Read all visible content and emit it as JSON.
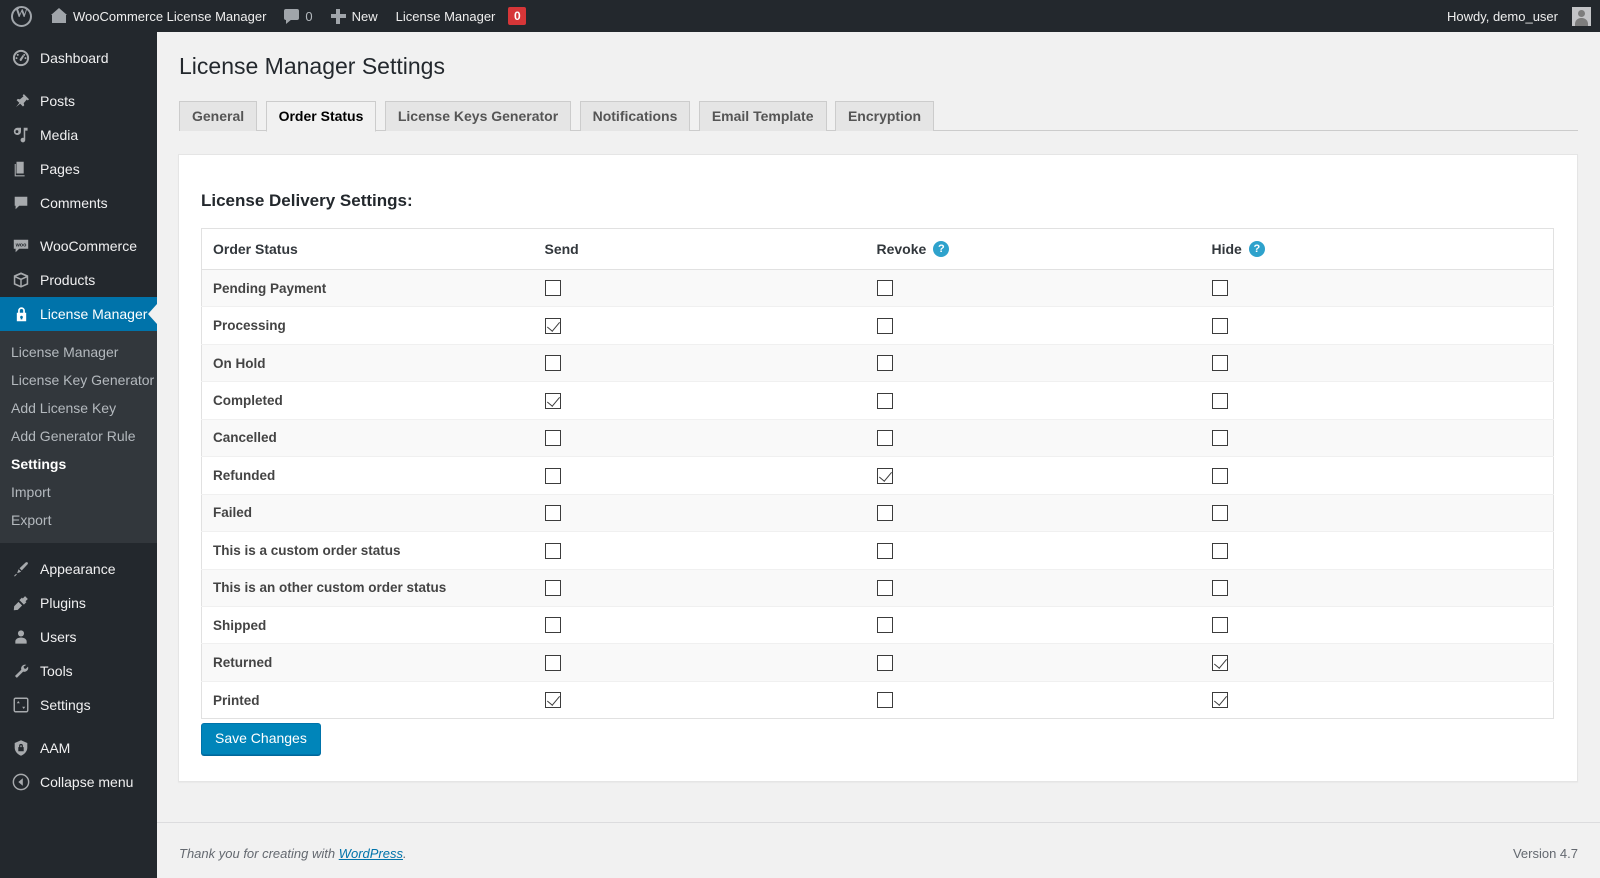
{
  "adminbar": {
    "wp_logo": "wordpress-logo-icon",
    "site_name": "WooCommerce License Manager",
    "comment_count": "0",
    "new_label": "New",
    "plugin_menu": "License Manager",
    "plugin_badge": "0",
    "howdy": "Howdy, demo_user"
  },
  "sidebar": {
    "items": [
      {
        "label": "Dashboard",
        "icon": "dashboard-icon",
        "current": false
      },
      {
        "label": "Posts",
        "icon": "pin-icon",
        "current": false
      },
      {
        "label": "Media",
        "icon": "media-icon",
        "current": false
      },
      {
        "label": "Pages",
        "icon": "pages-icon",
        "current": false
      },
      {
        "label": "Comments",
        "icon": "comments-icon",
        "current": false
      },
      {
        "label": "WooCommerce",
        "icon": "woocommerce-icon",
        "current": false
      },
      {
        "label": "Products",
        "icon": "products-box-icon",
        "current": false
      },
      {
        "label": "License Manager",
        "icon": "lock-icon",
        "current": true
      },
      {
        "label": "Appearance",
        "icon": "appearance-brush-icon",
        "current": false
      },
      {
        "label": "Plugins",
        "icon": "plugins-plug-icon",
        "current": false
      },
      {
        "label": "Users",
        "icon": "users-icon",
        "current": false
      },
      {
        "label": "Tools",
        "icon": "tools-wrench-icon",
        "current": false
      },
      {
        "label": "Settings",
        "icon": "settings-sliders-icon",
        "current": false
      },
      {
        "label": "AAM",
        "icon": "aam-shield-icon",
        "current": false
      },
      {
        "label": "Collapse menu",
        "icon": "collapse-arrow-icon",
        "current": false
      }
    ],
    "submenu": [
      {
        "label": "License Manager",
        "current": false
      },
      {
        "label": "License Key Generator",
        "current": false
      },
      {
        "label": "Add License Key",
        "current": false
      },
      {
        "label": "Add Generator Rule",
        "current": false
      },
      {
        "label": "Settings",
        "current": true
      },
      {
        "label": "Import",
        "current": false
      },
      {
        "label": "Export",
        "current": false
      }
    ]
  },
  "page": {
    "title": "License Manager Settings",
    "tabs": [
      {
        "label": "General",
        "active": false
      },
      {
        "label": "Order Status",
        "active": true
      },
      {
        "label": "License Keys Generator",
        "active": false
      },
      {
        "label": "Notifications",
        "active": false
      },
      {
        "label": "Email Template",
        "active": false
      },
      {
        "label": "Encryption",
        "active": false
      }
    ],
    "section_title": "License Delivery Settings:",
    "save_label": "Save Changes"
  },
  "table": {
    "headers": [
      {
        "label": "Order Status",
        "help": false
      },
      {
        "label": "Send",
        "help": false
      },
      {
        "label": "Revoke",
        "help": true,
        "help_glyph": "?"
      },
      {
        "label": "Hide",
        "help": true,
        "help_glyph": "?"
      }
    ],
    "rows": [
      {
        "status": "Pending Payment",
        "send": false,
        "revoke": false,
        "hide": false
      },
      {
        "status": "Processing",
        "send": true,
        "revoke": false,
        "hide": false
      },
      {
        "status": "On Hold",
        "send": false,
        "revoke": false,
        "hide": false
      },
      {
        "status": "Completed",
        "send": true,
        "revoke": false,
        "hide": false
      },
      {
        "status": "Cancelled",
        "send": false,
        "revoke": false,
        "hide": false
      },
      {
        "status": "Refunded",
        "send": false,
        "revoke": true,
        "hide": false
      },
      {
        "status": "Failed",
        "send": false,
        "revoke": false,
        "hide": false
      },
      {
        "status": "This is a custom order status",
        "send": false,
        "revoke": false,
        "hide": false
      },
      {
        "status": "This is an other custom order status",
        "send": false,
        "revoke": false,
        "hide": false
      },
      {
        "status": "Shipped",
        "send": false,
        "revoke": false,
        "hide": false
      },
      {
        "status": "Returned",
        "send": false,
        "revoke": false,
        "hide": true
      },
      {
        "status": "Printed",
        "send": true,
        "revoke": false,
        "hide": true
      }
    ]
  },
  "footer": {
    "thanks_prefix": "Thank you for creating with ",
    "link_label": "WordPress",
    "thanks_suffix": ".",
    "version": "Version 4.7"
  },
  "colors": {
    "admin_bar": "#23282d",
    "sidebar": "#23282d",
    "submenu": "#32373c",
    "accent": "#0073aa",
    "button": "#0085ba",
    "badge": "#d63638",
    "help": "#2ea2cc"
  }
}
